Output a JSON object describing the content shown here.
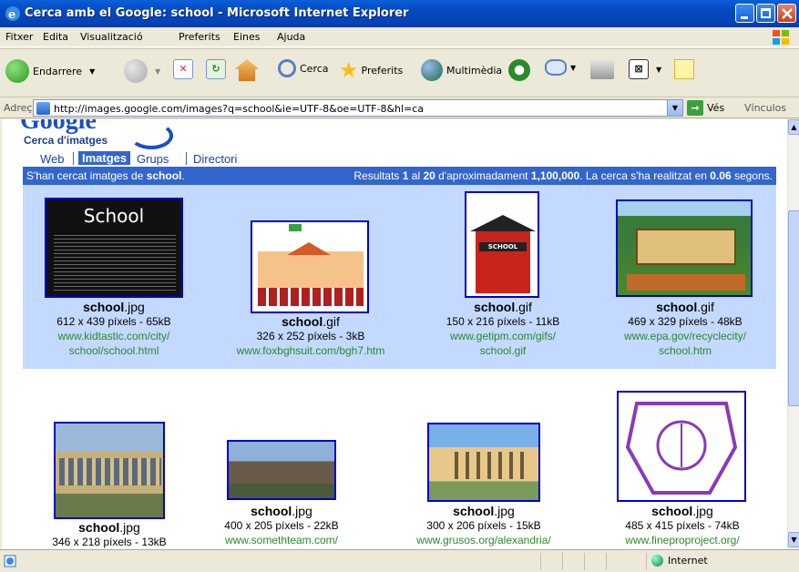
{
  "window": {
    "title": "Cerca amb el Google: school - Microsoft Internet Explorer"
  },
  "menu": [
    "Fitxer",
    "Edita",
    "Visualització",
    "Preferits",
    "Eines",
    "Ajuda"
  ],
  "toolbar": {
    "back": "Endarrere",
    "search": "Cerca",
    "favorites": "Preferits",
    "media": "Multimèdia"
  },
  "address": {
    "label": "Adreça",
    "url": "http://images.google.com/images?q=school&ie=UTF-8&oe=UTF-8&hl=ca",
    "go": "Vés",
    "links": "Vínculos"
  },
  "page": {
    "logo": "Google",
    "sublogo": "Cerca d'imatges",
    "tabs": [
      "Web",
      "Imatges",
      "Grups",
      "Directori"
    ],
    "searched_prefix": "S'han cercat imatges de ",
    "searched_term": "school",
    "searched_suffix": ".",
    "results_a": "Resultats ",
    "results_from": "1",
    "results_b": " al ",
    "results_to": "20",
    "results_c": " d'aproximadament ",
    "results_total": "1,100,000",
    "results_d": ". La cerca s'ha realitzat en ",
    "results_time": "0.06",
    "results_e": " segons."
  },
  "results": [
    {
      "name": "school",
      "ext": ".jpg",
      "size": "612 x 439 píxels - 65kB",
      "url1": "www.kidtastic.com/city/",
      "url2": "school/school.html",
      "thumb_title": "School"
    },
    {
      "name": "school",
      "ext": ".gif",
      "size": "326 x 252 píxels - 3kB",
      "url1": "www.foxbghsuit.com/bgh7.htm",
      "url2": ""
    },
    {
      "name": "school",
      "ext": ".gif",
      "size": "150 x 216 píxels - 11kB",
      "url1": "www.getipm.com/gifs/",
      "url2": "school.gif",
      "thumb_title": "SCHOOL"
    },
    {
      "name": "school",
      "ext": ".gif",
      "size": "469 x 329 píxels - 48kB",
      "url1": "www.epa.gov/recyclecity/",
      "url2": "school.htm"
    },
    {
      "name": "school",
      "ext": ".jpg",
      "size": "346 x 218 píxels - 13kB",
      "url1": "",
      "url2": ""
    },
    {
      "name": "school",
      "ext": ".jpg",
      "size": "400 x 205 píxels - 22kB",
      "url1": "www.somethteam.com/",
      "url2": ""
    },
    {
      "name": "school",
      "ext": ".jpg",
      "size": "300 x 206 píxels - 15kB",
      "url1": "www.grusos.org/alexandria/",
      "url2": ""
    },
    {
      "name": "school",
      "ext": ".jpg",
      "size": "485 x 415 píxels - 74kB",
      "url1": "www.fineproproject.org/",
      "url2": ""
    }
  ],
  "status": {
    "zone": "Internet"
  }
}
